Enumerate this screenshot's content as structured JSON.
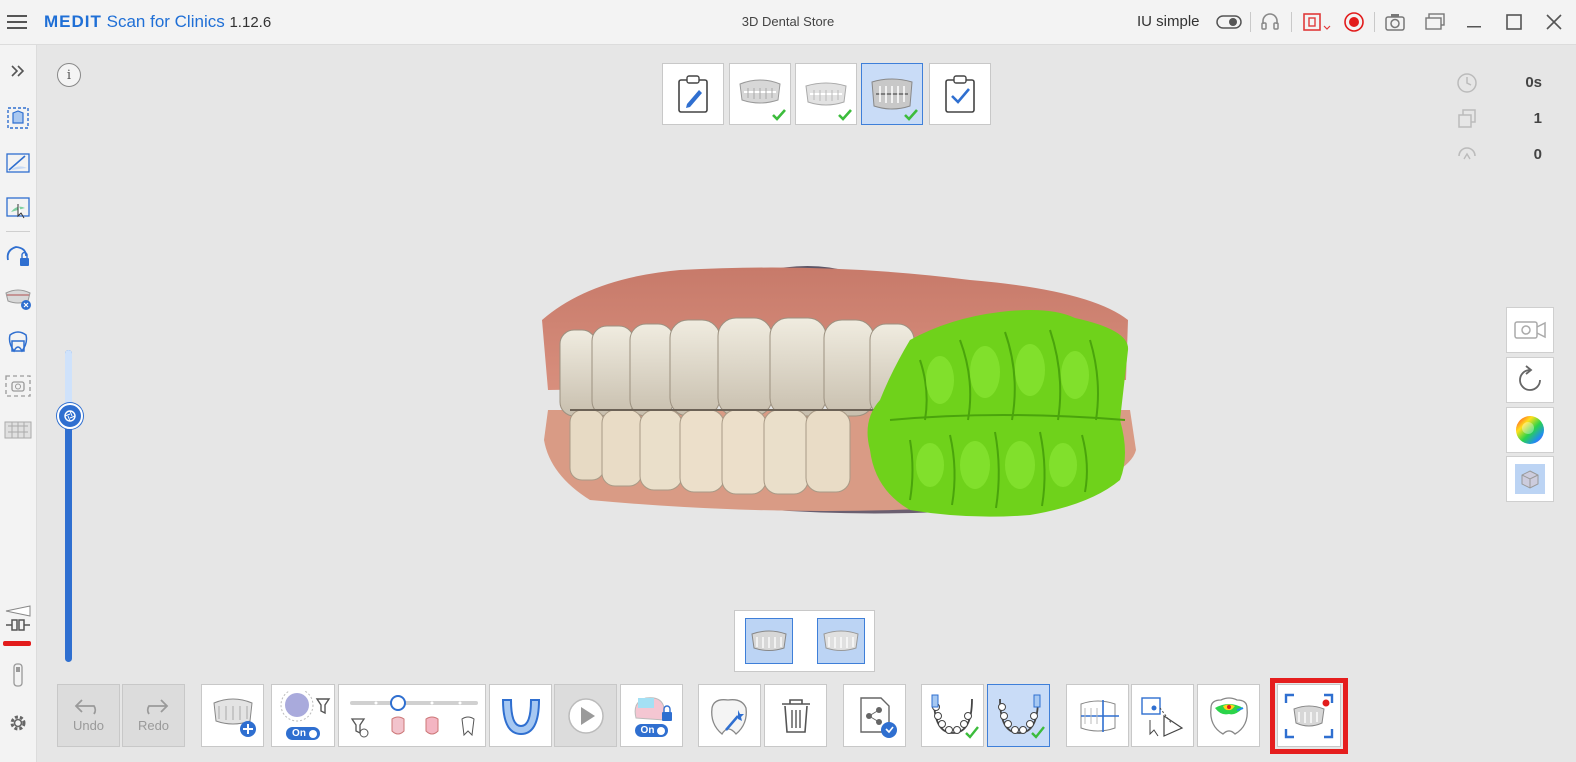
{
  "app": {
    "brand_primary": "MEDIT",
    "brand_secondary": "Scan for Clinics",
    "version": "1.12.6",
    "window_title": "3D Dental Store",
    "mode_label": "IU simple"
  },
  "stats": {
    "time": "0s",
    "count": "1",
    "pending": "0"
  },
  "toolbar": {
    "undo_label": "Undo",
    "redo_label": "Redo",
    "filter_toggle": "On",
    "lock_toggle": "On"
  },
  "colors": {
    "accent": "#2f6fd0",
    "brand": "#1f6fd6",
    "check": "#3cbc3c",
    "highlight": "#e51e1e",
    "scan_green": "#6fd21b"
  }
}
